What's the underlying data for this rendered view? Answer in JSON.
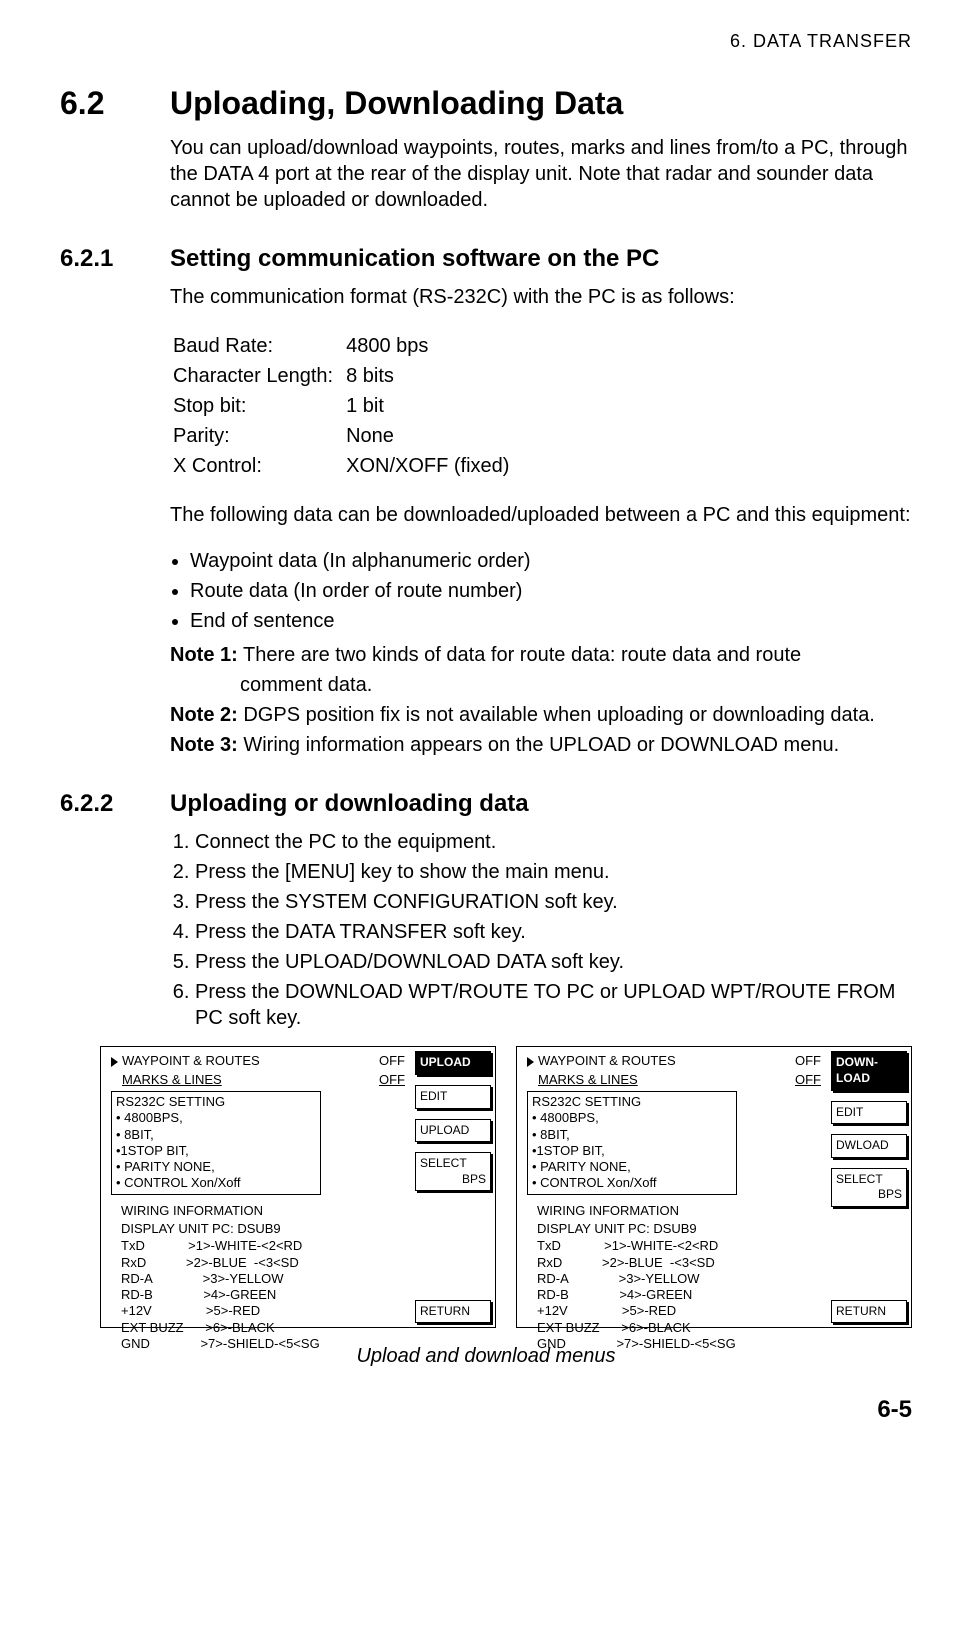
{
  "header": "6. DATA TRANSFER",
  "section": {
    "num": "6.2",
    "title": "Uploading, Downloading Data",
    "intro": "You can upload/download waypoints, routes, marks and lines from/to a PC, through the DATA 4 port at the rear of the display unit. Note that radar and sounder data cannot be uploaded or downloaded."
  },
  "sub1": {
    "num": "6.2.1",
    "title": "Setting communication software on the PC",
    "lead": "The communication format (RS-232C) with the PC is as follows:",
    "params": [
      [
        "Baud Rate:",
        "4800 bps"
      ],
      [
        "Character Length:",
        "8 bits"
      ],
      [
        "Stop bit:",
        "1 bit"
      ],
      [
        "Parity:",
        "None"
      ],
      [
        "X Control:",
        "XON/XOFF (fixed)"
      ]
    ],
    "mid": "The following data can be downloaded/uploaded between a PC and this equipment:",
    "bullets": [
      "Waypoint data (In alphanumeric order)",
      "Route data (In order of route number)",
      "End of sentence"
    ],
    "note1a": "Note 1:",
    "note1b": " There are two kinds of data for route data: route data and route",
    "note1c": "comment data.",
    "note2a": "Note 2:",
    "note2b": " DGPS position fix is not available when uploading or downloading data.",
    "note3a": "Note 3:",
    "note3b": " Wiring information appears on the UPLOAD or DOWNLOAD menu."
  },
  "sub2": {
    "num": "6.2.2",
    "title": "Uploading or downloading data",
    "steps": [
      "Connect the PC to the equipment.",
      "Press the [MENU] key to show the main menu.",
      "Press the SYSTEM CONFIGURATION soft key.",
      "Press the DATA TRANSFER soft key.",
      "Press the UPLOAD/DOWNLOAD DATA soft key.",
      "Press the DOWNLOAD WPT/ROUTE TO PC or UPLOAD WPT/ROUTE FROM PC soft key."
    ]
  },
  "menu": {
    "row1": {
      "label": "WAYPOINT & ROUTES",
      "val": "OFF"
    },
    "row2": {
      "label": "MARKS & LINES",
      "val": "OFF"
    },
    "rs232": {
      "title": "RS232C SETTING",
      "items": [
        "• 4800BPS,",
        "• 8BIT,",
        "•1STOP BIT,",
        "• PARITY NONE,",
        "• CONTROL Xon/Xoff"
      ]
    },
    "wiring": {
      "h1": "WIRING INFORMATION",
      "h2": "DISPLAY UNIT    PC: DSUB9",
      "rows": [
        "TxD            >1>-WHITE-<2<RD",
        "RxD           >2>-BLUE  -<3<SD",
        "RD-A              >3>-YELLOW",
        "RD-B              >4>-GREEN",
        "+12V               >5>-RED",
        "EXT BUZZ      >6>-BLACK",
        "GND              >7>-SHIELD-<5<SG"
      ]
    }
  },
  "softkeysUpload": {
    "k1": "UPLOAD",
    "k2": "EDIT",
    "k3": "UPLOAD",
    "k4a": "SELECT",
    "k4b": "BPS",
    "k5": "RETURN"
  },
  "softkeysDownload": {
    "k1a": "DOWN-",
    "k1b": "LOAD",
    "k2": "EDIT",
    "k3": "DWLOAD",
    "k4a": "SELECT",
    "k4b": "BPS",
    "k5": "RETURN"
  },
  "figcaption": "Upload and download menus",
  "pagefoot": "6-5"
}
